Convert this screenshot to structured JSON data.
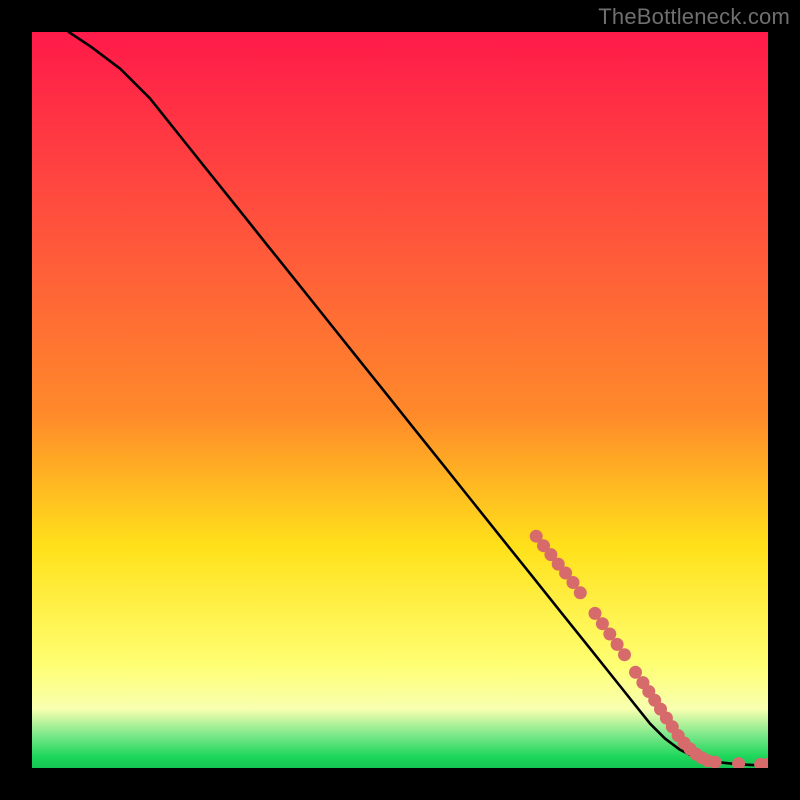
{
  "watermark": "TheBottleneck.com",
  "colors": {
    "frame": "#000000",
    "gradient_top": "#ff1a4a",
    "gradient_mid1": "#ff8a2a",
    "gradient_mid2": "#ffe11a",
    "gradient_band": "#ffff73",
    "gradient_green_top": "#7de88a",
    "gradient_green_bottom": "#1cd65a",
    "curve": "#000000",
    "marker": "#d76a6a"
  },
  "chart_data": {
    "type": "line",
    "title": "",
    "xlabel": "",
    "ylabel": "",
    "xlim": [
      0,
      100
    ],
    "ylim": [
      0,
      100
    ],
    "curve": {
      "x": [
        5,
        8,
        12,
        16,
        20,
        24,
        28,
        32,
        36,
        40,
        44,
        48,
        52,
        56,
        60,
        64,
        68,
        72,
        76,
        80,
        84,
        86,
        88,
        90,
        92,
        94,
        96,
        98,
        100
      ],
      "y": [
        100,
        98,
        95,
        91,
        86,
        81,
        76,
        71,
        66,
        61,
        56,
        51,
        46,
        41,
        36,
        31,
        26,
        21,
        16,
        11,
        6,
        4,
        2.5,
        1.5,
        1.0,
        0.7,
        0.5,
        0.4,
        0.4
      ]
    },
    "markers": [
      {
        "x": 68.5,
        "y": 31.5
      },
      {
        "x": 69.5,
        "y": 30.2
      },
      {
        "x": 70.5,
        "y": 29.0
      },
      {
        "x": 71.5,
        "y": 27.7
      },
      {
        "x": 72.5,
        "y": 26.5
      },
      {
        "x": 73.5,
        "y": 25.2
      },
      {
        "x": 74.5,
        "y": 23.8
      },
      {
        "x": 76.5,
        "y": 21.0
      },
      {
        "x": 77.5,
        "y": 19.6
      },
      {
        "x": 78.5,
        "y": 18.2
      },
      {
        "x": 79.5,
        "y": 16.8
      },
      {
        "x": 80.5,
        "y": 15.4
      },
      {
        "x": 82.0,
        "y": 13.0
      },
      {
        "x": 83.0,
        "y": 11.6
      },
      {
        "x": 83.8,
        "y": 10.4
      },
      {
        "x": 84.6,
        "y": 9.2
      },
      {
        "x": 85.4,
        "y": 8.0
      },
      {
        "x": 86.2,
        "y": 6.8
      },
      {
        "x": 87.0,
        "y": 5.6
      },
      {
        "x": 87.8,
        "y": 4.4
      },
      {
        "x": 88.6,
        "y": 3.4
      },
      {
        "x": 89.4,
        "y": 2.6
      },
      {
        "x": 90.2,
        "y": 1.9
      },
      {
        "x": 91.0,
        "y": 1.4
      },
      {
        "x": 91.8,
        "y": 1.0
      },
      {
        "x": 92.8,
        "y": 0.8
      },
      {
        "x": 96.0,
        "y": 0.6
      },
      {
        "x": 99.0,
        "y": 0.5
      },
      {
        "x": 100.0,
        "y": 0.5
      }
    ]
  }
}
